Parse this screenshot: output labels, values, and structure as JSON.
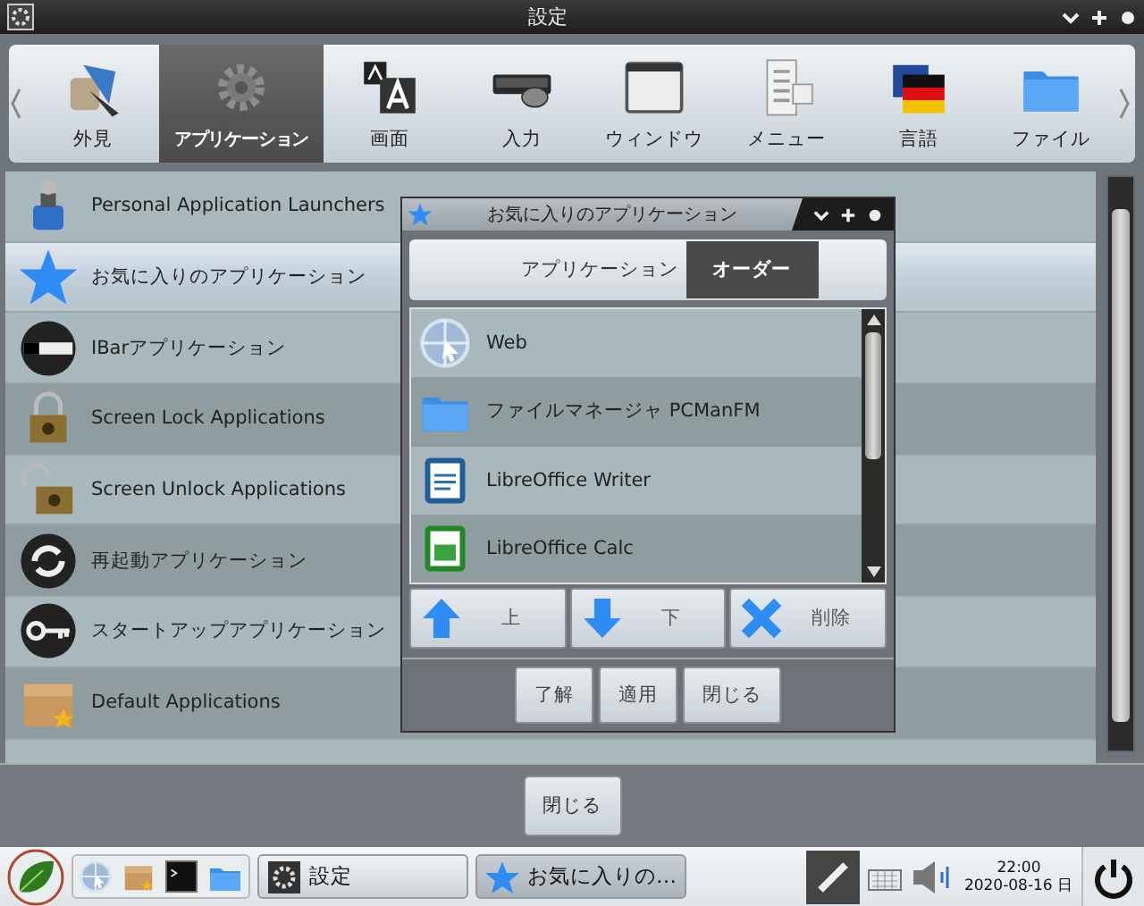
{
  "window": {
    "title": "設定"
  },
  "categories": [
    {
      "label": "外見",
      "kind": "appearance",
      "selected": false
    },
    {
      "label": "アプリケーション",
      "kind": "gear",
      "selected": true
    },
    {
      "label": "画面",
      "kind": "font",
      "selected": false
    },
    {
      "label": "入力",
      "kind": "mouse",
      "selected": false
    },
    {
      "label": "ウィンドウ",
      "kind": "window",
      "selected": false
    },
    {
      "label": "メニュー",
      "kind": "menu",
      "selected": false
    },
    {
      "label": "言語",
      "kind": "flag",
      "selected": false
    },
    {
      "label": "ファイル",
      "kind": "folder",
      "selected": false
    }
  ],
  "list": {
    "items": [
      {
        "label": "Personal Application Launchers",
        "kind": "launcher",
        "selected": false
      },
      {
        "label": "お気に入りのアプリケーション",
        "kind": "star",
        "selected": true
      },
      {
        "label": "IBarアプリケーション",
        "kind": "ibar",
        "selected": false
      },
      {
        "label": "Screen Lock Applications",
        "kind": "lock",
        "selected": false
      },
      {
        "label": "Screen Unlock Applications",
        "kind": "unlock",
        "selected": false
      },
      {
        "label": "再起動アプリケーション",
        "kind": "restart",
        "selected": false
      },
      {
        "label": "スタートアップアプリケーション",
        "kind": "key",
        "selected": false
      },
      {
        "label": "Default Applications",
        "kind": "package",
        "selected": false
      }
    ]
  },
  "dialog": {
    "title": "お気に入りのアプリケーション",
    "tabs": [
      {
        "label": "アプリケーション",
        "selected": false
      },
      {
        "label": "オーダー",
        "selected": true
      }
    ],
    "apps": [
      {
        "label": "Web",
        "kind": "web"
      },
      {
        "label": "ファイルマネージャ PCManFM",
        "kind": "folder"
      },
      {
        "label": "LibreOffice Writer",
        "kind": "writer"
      },
      {
        "label": "LibreOffice Calc",
        "kind": "calc"
      }
    ],
    "actions": [
      {
        "label": "上",
        "kind": "up"
      },
      {
        "label": "下",
        "kind": "down"
      },
      {
        "label": "削除",
        "kind": "delete"
      }
    ],
    "buttons": [
      "了解",
      "適用",
      "閉じる"
    ]
  },
  "close_button": "閉じる",
  "taskbar": {
    "windows": [
      {
        "label": "設定",
        "kind": "settings",
        "selected": false
      },
      {
        "label": "お気に入りの…",
        "kind": "star",
        "selected": true
      }
    ],
    "clock": {
      "time": "22:00",
      "date": "2020-08-16 日"
    }
  }
}
